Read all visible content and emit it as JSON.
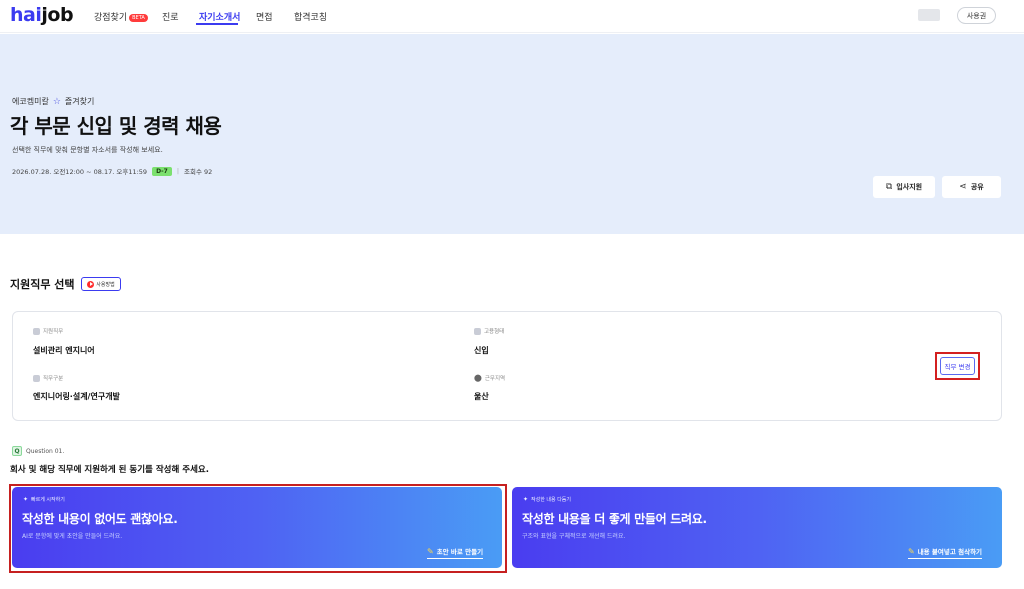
{
  "nav": {
    "logo_main": "hai",
    "logo_sub": "job",
    "items": [
      {
        "label": "강점찾기",
        "badge": "BETA"
      },
      {
        "label": "진로"
      },
      {
        "label": "자기소개서",
        "active": true
      },
      {
        "label": "면접"
      },
      {
        "label": "합격코칭"
      }
    ],
    "user_button": "사용권"
  },
  "hero": {
    "company": "에코켐미칼",
    "favorite_label": "즐겨찾기",
    "title": "각 부문 신입 및 경력 채용",
    "subtitle": "선택한 직무에 맞춰 문항별 자소서를 작성해 보세요.",
    "period": "2026.07.28. 오전12:00 ~ 08.17. 오후11:59",
    "dday": "D-7",
    "views": "조회수 92",
    "buttons": {
      "apply": "입사지원",
      "share": "공유"
    }
  },
  "job_section": {
    "title": "지원직무 선택",
    "video_label": "사용방법",
    "fields": {
      "job_label": "지원직무",
      "job_value": "설비관리 엔지니어",
      "employment_label": "고용형태",
      "employment_value": "신입",
      "category_label": "직무구분",
      "category_value": "엔지니어링·설계/연구개발",
      "location_label": "근무지역",
      "location_value": "울산"
    },
    "change_button": "직무 변경"
  },
  "question": {
    "number_label": "Question 01.",
    "text": "회사 및 해당 직무에 지원하게 된 동기를 작성해 주세요."
  },
  "ai_cards": [
    {
      "chip": "빠르게 시작하기",
      "headline": "작성한 내용이 없어도 괜찮아요.",
      "desc": "AI로 문항에 맞게 초안을 만들어 드려요.",
      "action": "초안 바로 만들기"
    },
    {
      "chip": "작성한 내용 다듬기",
      "headline": "작성한 내용을 더 좋게 만들어 드려요.",
      "desc": "구조와 표현을 구체적으로 개선해 드려요.",
      "action": "내용 붙여넣고 첨삭하기"
    }
  ],
  "colors": {
    "brand": "#3b3bf0",
    "hero_bg": "#e5edfb",
    "dday": "#7be06e",
    "highlight": "#c62020"
  }
}
